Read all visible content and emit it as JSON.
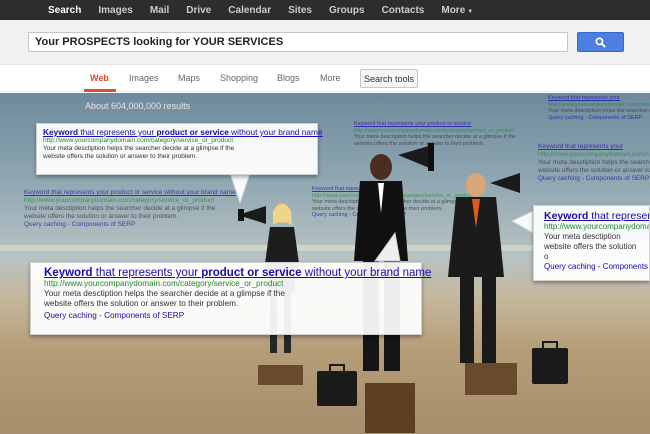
{
  "topbar": {
    "items": [
      {
        "label": "Search",
        "active": true
      },
      {
        "label": "Images"
      },
      {
        "label": "Mail"
      },
      {
        "label": "Drive"
      },
      {
        "label": "Calendar"
      },
      {
        "label": "Sites"
      },
      {
        "label": "Groups"
      },
      {
        "label": "Contacts"
      },
      {
        "label": "More"
      }
    ]
  },
  "search": {
    "query": "Your PROSPECTS looking for YOUR SERVICES",
    "button_icon": "search-icon"
  },
  "tabs": {
    "items": [
      {
        "label": "Web",
        "active": true
      },
      {
        "label": "Images"
      },
      {
        "label": "Maps"
      },
      {
        "label": "Shopping"
      },
      {
        "label": "Blogs"
      },
      {
        "label": "More"
      }
    ],
    "tools_label": "Search tools"
  },
  "results": {
    "count": "About 604,000,000 results",
    "title_prefix": "Keyword",
    "title_mid1": " that represents your ",
    "title_bold": "product or service",
    "title_suffix": " without your brand name",
    "url": "http://www.yourcompanydomain.com/category/service_or_product",
    "desc_line1": "Your meta desctiption helps the searcher decide at a glimpse if the",
    "desc_line2": "website offers the solution or answer to their problem.",
    "desc_right_line1": "Your meta desctiption",
    "desc_right_line2": "website offers the solution o",
    "links": "Query caching - Components of SERP"
  },
  "colors": {
    "topbar_bg": "#2d2d2d",
    "link": "#1a0dab",
    "url_green": "#1e8a2e",
    "accent_red": "#dd4b39",
    "search_blue": "#4d7fe0"
  }
}
